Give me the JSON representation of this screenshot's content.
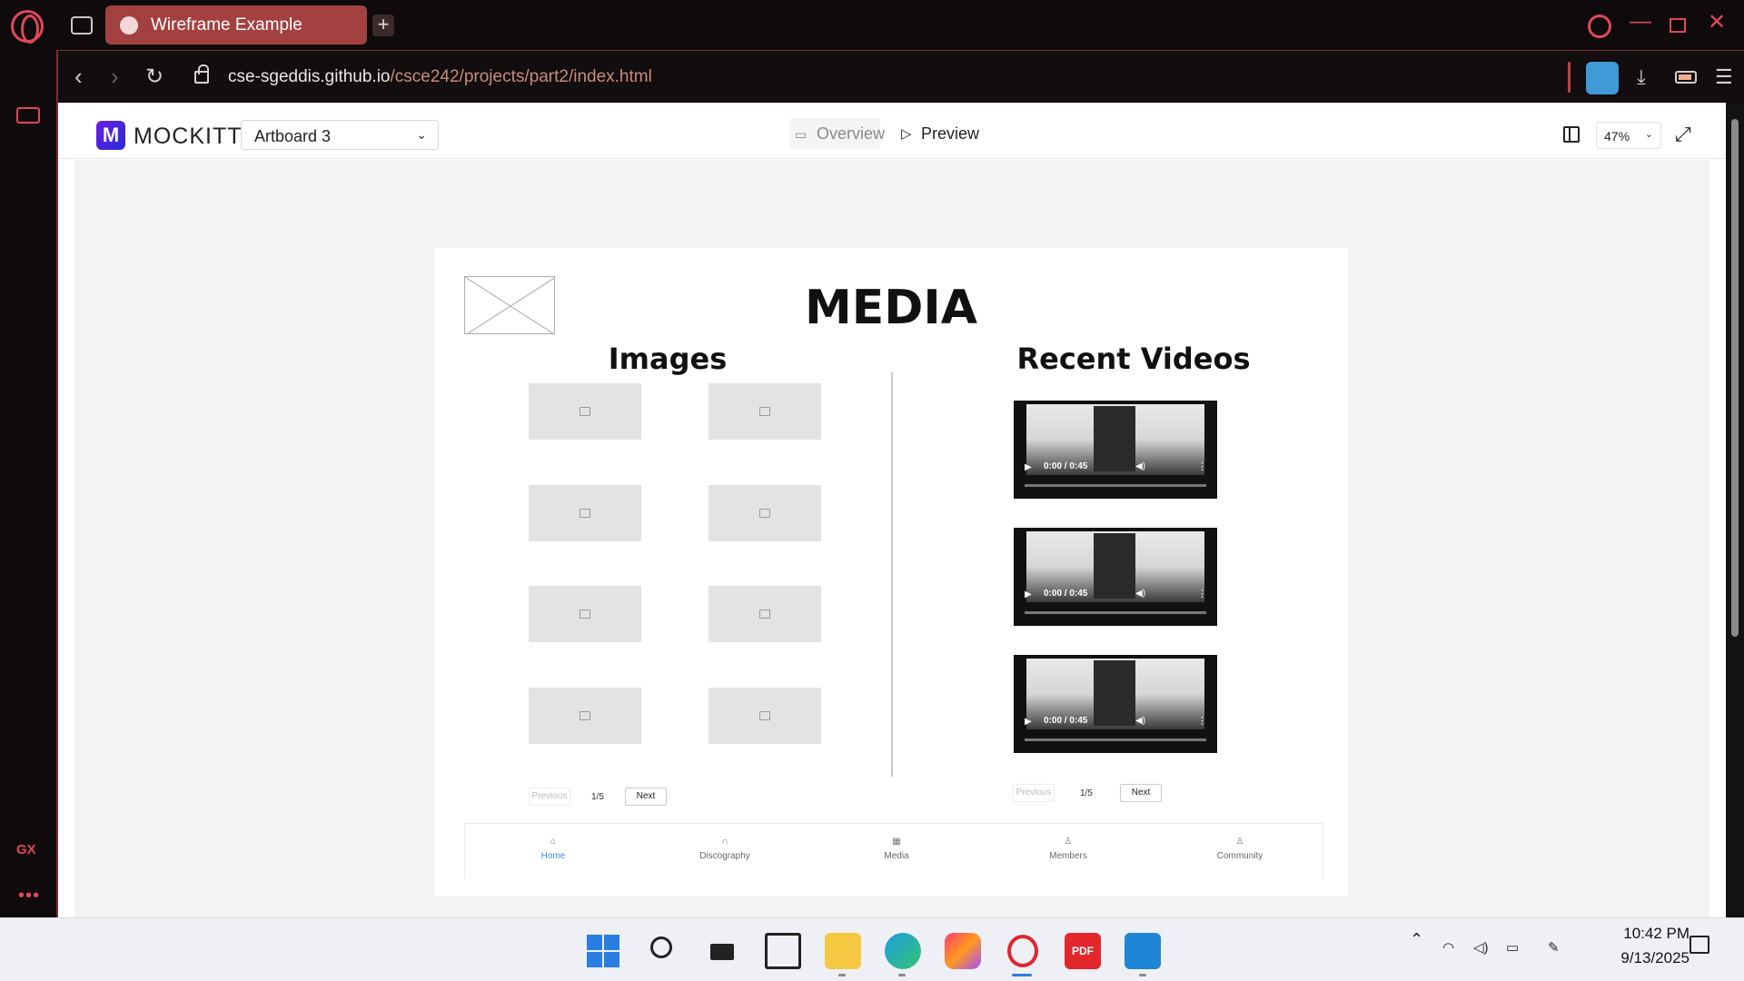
{
  "browser": {
    "tab_title": "Wireframe Example",
    "new_tab_label": "+",
    "url_host": "cse-sgeddis.github.io",
    "url_path": "/csce242/projects/part2/index.html",
    "sidebar_gx_label": "GX",
    "sidebar_more_label": "•••",
    "accent_color": "#e0485a",
    "tab_color": "#a34140"
  },
  "mockitt": {
    "brand": "MOCKITT",
    "logo_letter": "M",
    "artboard_select": "Artboard 3",
    "overview_label": "Overview",
    "preview_label": "Preview",
    "zoom_value": "47%"
  },
  "artboard": {
    "title": "MEDIA",
    "images_heading": "Images",
    "videos_heading": "Recent Videos",
    "video_time": "0:00 / 0:45",
    "images_pager": {
      "prev": "Previous",
      "count": "1/5",
      "next": "Next"
    },
    "videos_pager": {
      "prev": "Previous",
      "count": "1/5",
      "next": "Next"
    },
    "nav": [
      "Home",
      "Discography",
      "Media",
      "Members",
      "Community"
    ],
    "nav_active_color": "#3a8ee6"
  },
  "taskbar": {
    "time": "10:42 PM",
    "date": "9/13/2025",
    "pdf_label": "PDF"
  }
}
